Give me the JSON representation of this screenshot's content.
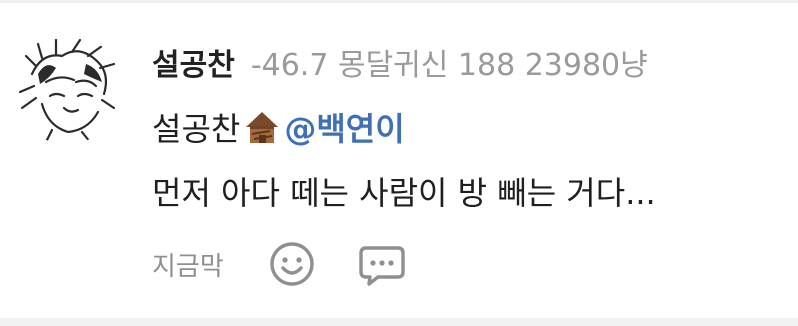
{
  "comment": {
    "author": "설공찬",
    "meta": "-46.7 몽달귀신 188 23980냥",
    "line1_prefix": "설공찬",
    "line1_icon": "house-emoji-icon",
    "mention": "@백연이",
    "line2": "먼저 아다 떼는 사람이 방 빼는 거다..."
  },
  "actions": {
    "time_label": "지금막",
    "react_icon": "smiley-icon",
    "reply_icon": "speech-bubble-icon"
  },
  "colors": {
    "author": "#222222",
    "meta": "#9a9a9a",
    "mention": "#3f6fb5",
    "icon": "#8f8f8f"
  }
}
